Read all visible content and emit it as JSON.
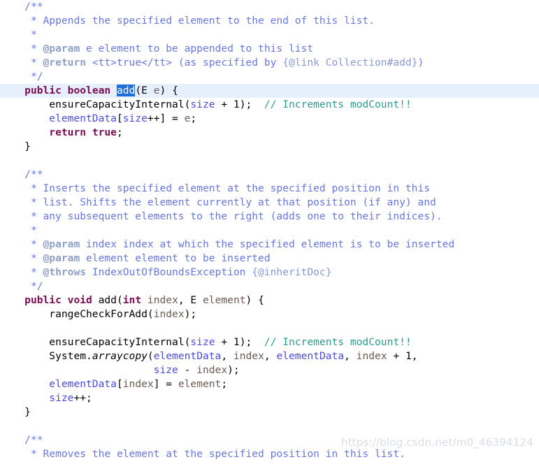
{
  "editor": {
    "language": "java",
    "background_color": "#ffffff",
    "current_line_highlight_color": "#e6effc",
    "selection_color": "#1e6fd9",
    "font_size_px": 14.6,
    "line_height_px": 20,
    "colors": {
      "keyword": "#7a0b52",
      "javadoc": "#6878e0",
      "javadoc_tag": "#8ea0c8",
      "line_comment": "#2a9d8f",
      "field": "#4b4bdd",
      "local_variable": "#6b5b53",
      "plain_text": "#000000",
      "selection_text": "#ffffff",
      "watermark": "#d9dde6"
    }
  },
  "watermark": {
    "text": "https://blog.csdn.net/m0_46394124"
  },
  "selection": {
    "selected_token": "add"
  },
  "lines": [
    {
      "n": 1,
      "indent": 4,
      "current": false,
      "tokens": [
        {
          "c": "doc",
          "t": "/**"
        }
      ]
    },
    {
      "n": 2,
      "indent": 5,
      "current": false,
      "tokens": [
        {
          "c": "doc",
          "t": "* Appends the specified element to the end of this list."
        }
      ]
    },
    {
      "n": 3,
      "indent": 5,
      "current": false,
      "tokens": [
        {
          "c": "doc",
          "t": "*"
        }
      ]
    },
    {
      "n": 4,
      "indent": 5,
      "current": false,
      "tokens": [
        {
          "c": "doc",
          "t": "* "
        },
        {
          "c": "doct",
          "t": "@param"
        },
        {
          "c": "doc",
          "t": " e element to be appended to this list"
        }
      ]
    },
    {
      "n": 5,
      "indent": 5,
      "current": false,
      "tokens": [
        {
          "c": "doc",
          "t": "* "
        },
        {
          "c": "doct",
          "t": "@return"
        },
        {
          "c": "doc",
          "t": " <tt>true</tt> (as specified by "
        },
        {
          "c": "doclink",
          "t": "{@link Collection#add}"
        },
        {
          "c": "doc",
          "t": ")"
        }
      ]
    },
    {
      "n": 6,
      "indent": 5,
      "current": false,
      "tokens": [
        {
          "c": "doc",
          "t": "*/"
        }
      ]
    },
    {
      "n": 7,
      "indent": 4,
      "current": true,
      "tokens": [
        {
          "c": "kw",
          "t": "public"
        },
        {
          "c": "plain",
          "t": " "
        },
        {
          "c": "kw",
          "t": "boolean"
        },
        {
          "c": "plain",
          "t": " "
        },
        {
          "c": "sel",
          "t": "add"
        },
        {
          "c": "plain",
          "t": "(E "
        },
        {
          "c": "loc",
          "t": "e"
        },
        {
          "c": "plain",
          "t": ") {"
        }
      ]
    },
    {
      "n": 8,
      "indent": 8,
      "current": false,
      "tokens": [
        {
          "c": "plain",
          "t": "ensureCapacityInternal("
        },
        {
          "c": "fld",
          "t": "size"
        },
        {
          "c": "plain",
          "t": " + 1);  "
        },
        {
          "c": "cmt",
          "t": "// Increments modCount!!"
        }
      ]
    },
    {
      "n": 9,
      "indent": 8,
      "current": false,
      "tokens": [
        {
          "c": "fld",
          "t": "elementData"
        },
        {
          "c": "plain",
          "t": "["
        },
        {
          "c": "fld",
          "t": "size"
        },
        {
          "c": "plain",
          "t": "++] = "
        },
        {
          "c": "loc",
          "t": "e"
        },
        {
          "c": "plain",
          "t": ";"
        }
      ]
    },
    {
      "n": 10,
      "indent": 8,
      "current": false,
      "tokens": [
        {
          "c": "kw",
          "t": "return"
        },
        {
          "c": "plain",
          "t": " "
        },
        {
          "c": "kw",
          "t": "true"
        },
        {
          "c": "plain",
          "t": ";"
        }
      ]
    },
    {
      "n": 11,
      "indent": 4,
      "current": false,
      "tokens": [
        {
          "c": "plain",
          "t": "}"
        }
      ]
    },
    {
      "n": 12,
      "indent": 0,
      "current": false,
      "tokens": []
    },
    {
      "n": 13,
      "indent": 4,
      "current": false,
      "tokens": [
        {
          "c": "doc",
          "t": "/**"
        }
      ]
    },
    {
      "n": 14,
      "indent": 5,
      "current": false,
      "tokens": [
        {
          "c": "doc",
          "t": "* Inserts the specified element at the specified position in this"
        }
      ]
    },
    {
      "n": 15,
      "indent": 5,
      "current": false,
      "tokens": [
        {
          "c": "doc",
          "t": "* list. Shifts the element currently at that position (if any) and"
        }
      ]
    },
    {
      "n": 16,
      "indent": 5,
      "current": false,
      "tokens": [
        {
          "c": "doc",
          "t": "* any subsequent elements to the right (adds one to their indices)."
        }
      ]
    },
    {
      "n": 17,
      "indent": 5,
      "current": false,
      "tokens": [
        {
          "c": "doc",
          "t": "*"
        }
      ]
    },
    {
      "n": 18,
      "indent": 5,
      "current": false,
      "tokens": [
        {
          "c": "doc",
          "t": "* "
        },
        {
          "c": "doct",
          "t": "@param"
        },
        {
          "c": "doc",
          "t": " index index at which the specified element is to be inserted"
        }
      ]
    },
    {
      "n": 19,
      "indent": 5,
      "current": false,
      "tokens": [
        {
          "c": "doc",
          "t": "* "
        },
        {
          "c": "doct",
          "t": "@param"
        },
        {
          "c": "doc",
          "t": " element element to be inserted"
        }
      ]
    },
    {
      "n": 20,
      "indent": 5,
      "current": false,
      "tokens": [
        {
          "c": "doc",
          "t": "* "
        },
        {
          "c": "doct",
          "t": "@throws"
        },
        {
          "c": "doc",
          "t": " IndexOutOfBoundsException "
        },
        {
          "c": "doclink",
          "t": "{@inheritDoc}"
        }
      ]
    },
    {
      "n": 21,
      "indent": 5,
      "current": false,
      "tokens": [
        {
          "c": "doc",
          "t": "*/"
        }
      ]
    },
    {
      "n": 22,
      "indent": 4,
      "current": false,
      "tokens": [
        {
          "c": "kw",
          "t": "public"
        },
        {
          "c": "plain",
          "t": " "
        },
        {
          "c": "kw",
          "t": "void"
        },
        {
          "c": "plain",
          "t": " add("
        },
        {
          "c": "kw",
          "t": "int"
        },
        {
          "c": "plain",
          "t": " "
        },
        {
          "c": "loc",
          "t": "index"
        },
        {
          "c": "plain",
          "t": ", E "
        },
        {
          "c": "loc",
          "t": "element"
        },
        {
          "c": "plain",
          "t": ") {"
        }
      ]
    },
    {
      "n": 23,
      "indent": 8,
      "current": false,
      "tokens": [
        {
          "c": "plain",
          "t": "rangeCheckForAdd("
        },
        {
          "c": "loc",
          "t": "index"
        },
        {
          "c": "plain",
          "t": ");"
        }
      ]
    },
    {
      "n": 24,
      "indent": 0,
      "current": false,
      "tokens": []
    },
    {
      "n": 25,
      "indent": 8,
      "current": false,
      "tokens": [
        {
          "c": "plain",
          "t": "ensureCapacityInternal("
        },
        {
          "c": "fld",
          "t": "size"
        },
        {
          "c": "plain",
          "t": " + 1);  "
        },
        {
          "c": "cmt",
          "t": "// Increments modCount!!"
        }
      ]
    },
    {
      "n": 26,
      "indent": 8,
      "current": false,
      "tokens": [
        {
          "c": "plain",
          "t": "System."
        },
        {
          "c": "ital",
          "t": "arraycopy"
        },
        {
          "c": "plain",
          "t": "("
        },
        {
          "c": "fld",
          "t": "elementData"
        },
        {
          "c": "plain",
          "t": ", "
        },
        {
          "c": "loc",
          "t": "index"
        },
        {
          "c": "plain",
          "t": ", "
        },
        {
          "c": "fld",
          "t": "elementData"
        },
        {
          "c": "plain",
          "t": ", "
        },
        {
          "c": "loc",
          "t": "index"
        },
        {
          "c": "plain",
          "t": " + 1,"
        }
      ]
    },
    {
      "n": 27,
      "indent": 25,
      "current": false,
      "tokens": [
        {
          "c": "fld",
          "t": "size"
        },
        {
          "c": "plain",
          "t": " - "
        },
        {
          "c": "loc",
          "t": "index"
        },
        {
          "c": "plain",
          "t": ");"
        }
      ]
    },
    {
      "n": 28,
      "indent": 8,
      "current": false,
      "tokens": [
        {
          "c": "fld",
          "t": "elementData"
        },
        {
          "c": "plain",
          "t": "["
        },
        {
          "c": "loc",
          "t": "index"
        },
        {
          "c": "plain",
          "t": "] = "
        },
        {
          "c": "loc",
          "t": "element"
        },
        {
          "c": "plain",
          "t": ";"
        }
      ]
    },
    {
      "n": 29,
      "indent": 8,
      "current": false,
      "tokens": [
        {
          "c": "fld",
          "t": "size"
        },
        {
          "c": "plain",
          "t": "++;"
        }
      ]
    },
    {
      "n": 30,
      "indent": 4,
      "current": false,
      "tokens": [
        {
          "c": "plain",
          "t": "}"
        }
      ]
    },
    {
      "n": 31,
      "indent": 0,
      "current": false,
      "tokens": []
    },
    {
      "n": 32,
      "indent": 4,
      "current": false,
      "tokens": [
        {
          "c": "doc",
          "t": "/**"
        }
      ]
    },
    {
      "n": 33,
      "indent": 5,
      "current": false,
      "tokens": [
        {
          "c": "doc",
          "t": "* Removes the element at the specified position in this list."
        }
      ]
    }
  ]
}
